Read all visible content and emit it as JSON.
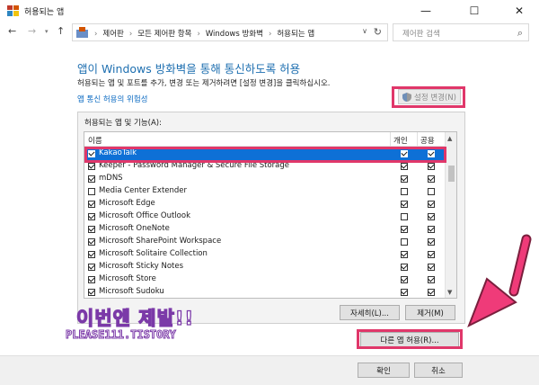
{
  "window": {
    "title": "허용되는 앱",
    "minimize": "—",
    "maximize": "☐",
    "close": "✕"
  },
  "address": {
    "crumbs": [
      "제어판",
      "모든 제어판 항목",
      "Windows 방화벽",
      "허용되는 앱"
    ],
    "search_placeholder": "제어판 검색"
  },
  "main": {
    "heading": "앱이 Windows 방화벽을 통해 통신하도록 허용",
    "subtext": "허용되는 앱 및 포트를 추가, 변경 또는 제거하려면 [설정 변경]을 클릭하십시오.",
    "risk_link": "앱 통신 허용의 위험성",
    "change_settings": "설정 변경(N)"
  },
  "apps": {
    "group_label": "허용되는 앱 및 기능(A):",
    "columns": {
      "name": "이름",
      "private": "개인",
      "public": "공용"
    },
    "rows": [
      {
        "name": "KakaoTalk",
        "enabled": true,
        "private": true,
        "public": true
      },
      {
        "name": "Keeper - Password Manager & Secure File Storage",
        "enabled": true,
        "private": true,
        "public": true
      },
      {
        "name": "mDNS",
        "enabled": true,
        "private": true,
        "public": true
      },
      {
        "name": "Media Center Extender",
        "enabled": false,
        "private": false,
        "public": false
      },
      {
        "name": "Microsoft Edge",
        "enabled": true,
        "private": true,
        "public": true
      },
      {
        "name": "Microsoft Office Outlook",
        "enabled": true,
        "private": false,
        "public": true
      },
      {
        "name": "Microsoft OneNote",
        "enabled": true,
        "private": true,
        "public": true
      },
      {
        "name": "Microsoft SharePoint Workspace",
        "enabled": true,
        "private": false,
        "public": true
      },
      {
        "name": "Microsoft Solitaire Collection",
        "enabled": true,
        "private": true,
        "public": true
      },
      {
        "name": "Microsoft Sticky Notes",
        "enabled": true,
        "private": true,
        "public": true
      },
      {
        "name": "Microsoft Store",
        "enabled": true,
        "private": true,
        "public": true
      },
      {
        "name": "Microsoft Sudoku",
        "enabled": true,
        "private": true,
        "public": true
      }
    ],
    "details_button": "자세히(L)...",
    "remove_button": "제거(M)",
    "other_app_button": "다른 앱 허용(R)..."
  },
  "overlay": {
    "line1": "이번엔 제발!!",
    "line2": "PLEASE111.TISTORY"
  },
  "footer": {
    "ok": "확인",
    "cancel": "취소"
  },
  "colors": {
    "highlight": "#e0376a",
    "selection": "#0e70d6",
    "heading": "#1e6fb0"
  }
}
